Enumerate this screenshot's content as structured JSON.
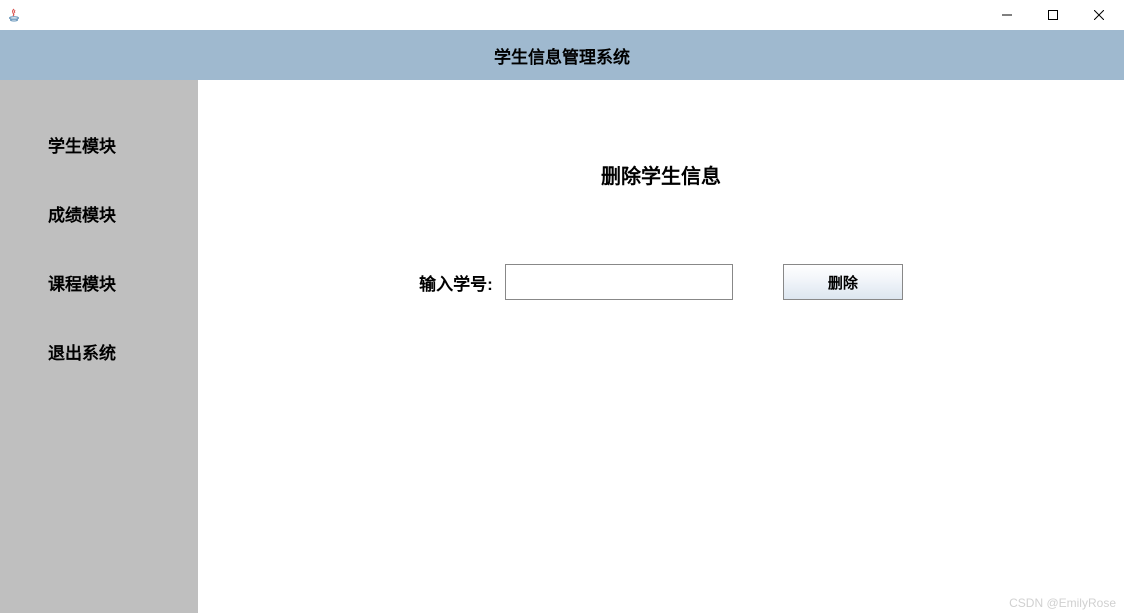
{
  "titlebar": {
    "title": ""
  },
  "header": {
    "title": "学生信息管理系统"
  },
  "sidebar": {
    "items": [
      {
        "label": "学生模块"
      },
      {
        "label": "成绩模块"
      },
      {
        "label": "课程模块"
      },
      {
        "label": "退出系统"
      }
    ]
  },
  "content": {
    "title": "删除学生信息",
    "form": {
      "student_id_label": "输入学号:",
      "student_id_value": "",
      "delete_button_label": "删除"
    }
  },
  "watermark": "CSDN @EmilyRose"
}
